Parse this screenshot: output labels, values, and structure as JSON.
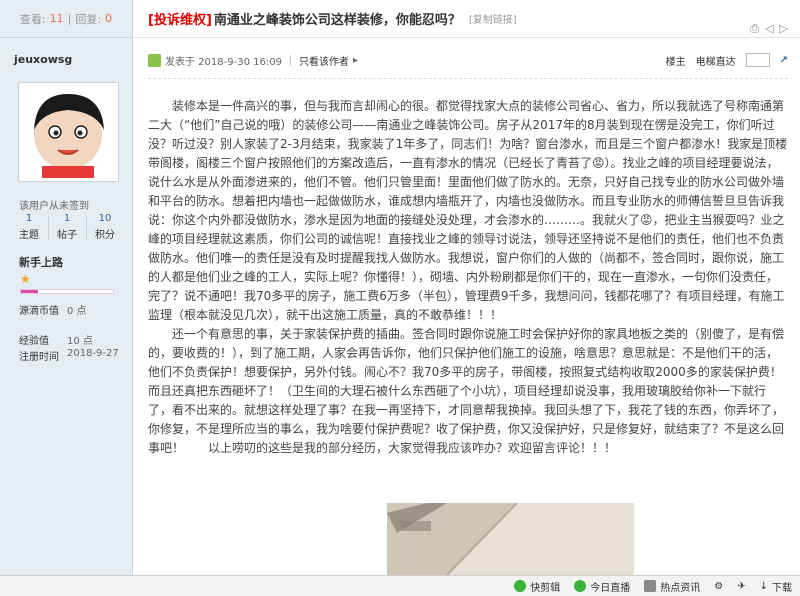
{
  "sidebar": {
    "views_label": "查看:",
    "views": "11",
    "replies_label": "回复:",
    "replies": "0",
    "username": "jeuxowsg",
    "note": "该用户从未签到",
    "stats": [
      {
        "value": "1",
        "label": "主题"
      },
      {
        "value": "1",
        "label": "帖子"
      },
      {
        "value": "10",
        "label": "积分"
      }
    ],
    "rank": "新手上路",
    "progress": 0.18,
    "rows": [
      {
        "key": "源滴币值",
        "value": "0 点"
      },
      {
        "key": "经验值",
        "value": "10 点"
      },
      {
        "key": "注册时间",
        "value": "2018-9-27"
      }
    ]
  },
  "post": {
    "tag": "[投诉维权]",
    "title": "南通业之峰装饰公司这样装修，你能忍吗？",
    "copy_link": "[复制链接]",
    "posted": "发表于 2018-9-30 16:09",
    "author_only": "只看该作者",
    "floor": "楼主",
    "jump_label": "电梯直达",
    "paragraph1": "装修本是一件高兴的事，但与我而言却闹心的很。都觉得找家大点的装修公司省心、省力，所以我就选了号称南通第二大（“他们”自己说的哦）的装修公司——南通业之峰装饰公司。房子从2017年的8月装到现在愣是没完工，你们听过没？听过没？别人家装了2-3月结束，我家装了1年多了，同志们！为啥？窗台渗水，而且是三个窗户都渗水！我家是顶楼带阁楼，阁楼三个窗户按照他们的方案改造后，一直有渗水的情况（已经长了青苔了😡）。找业之峰的项目经理要说法，说什么水是从外面渗进来的，他们不管。他们只管里面！里面他们做了防水的。无奈，只好自己找专业的防水公司做外墙和平台的防水。想着把内墙也一起做做防水，谁成想内墙瓶开了，内墙也没做防水。而且专业防水的师傅信誓旦旦告诉我说：你这个内外都没做防水，渗水是因为地面的接缝处没处理，才会渗水的………。我就火了😡，把业主当猴耍吗？业之峰的项目经理就这素质，你们公司的诚信呢！直接找业之峰的领导讨说法，领导还坚持说不是他们的责任，他们也不负责做防水。他们唯一的责任是没有及时提醒我找人做防水。我想说，窗户你们的人做的（尚都不，签合同时，跟你说，施工的人都是他们业之峰的工人，实际上呢？你懂得！），砌墙、内外粉刷都是你们干的，现在一直渗水，一句你们没责任，完了？说不通吧！我70多平的房子，施工费6万多（半包），管理费9千多，我想问问，钱都花哪了？有项目经理，有施工监理（根本就没见几次），就干出这施工质量，真的不敢恭维！！！",
    "paragraph2": "还一个有意思的事，关于家装保护费的插曲。签合同时跟你说施工时会保护好你的家具地板之类的（别傻了，是有偿的，要收费的！），到了施工期，人家会再告诉你，他们只保护他们施工的设施，啥意思？意思就是：不是他们干的活，他们不负责保护！想要保护，另外付钱。闹心不？我70多平的房子，带阁楼，按照复式结构收取2000多的家装保护费！而且还真把东西砸坏了！（卫生间的大理石被什么东西砸了个小坑），项目经理却说没事，我用玻璃胶给你补一下就行了，看不出来的。就想这样处理了事？在我一再坚持下，才同意帮我换掉。我回头想了下，我花了钱的东西，你弄坏了，你修复，不是理所应当的事么，我为啥要付保护费呢？收了保护费，你又没保护好，只是修复好，就结束了？不是这么回事吧！　　以上唠叨的这些是我的部分经历，大家觉得我应该咋办？欢迎留言评论！！！"
  },
  "toolbar": {
    "items": [
      {
        "label": "快剪辑",
        "icon": "scissors-icon",
        "color": "#3bb33b"
      },
      {
        "label": "今日直播",
        "icon": "play-icon",
        "color": "#3bb33b"
      },
      {
        "label": "热点资讯",
        "icon": "news-icon",
        "color": "#666666"
      },
      {
        "label": "下载",
        "icon": "download-icon",
        "color": "#666666"
      }
    ]
  }
}
